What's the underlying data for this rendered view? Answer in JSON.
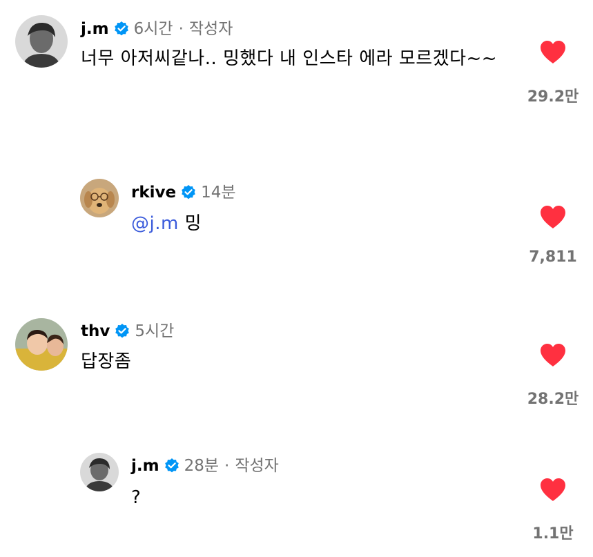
{
  "comments": [
    {
      "username": "j.m",
      "time": "6시간",
      "author_tag": "작성자",
      "text": "너무 아저씨같나.. 밍했다 내 인스타 에라 모르겠다~~",
      "likes": "29.2만",
      "avatar_icon": "profile-photo"
    },
    {
      "username": "rkive",
      "time": "14분",
      "mention": "@j.m",
      "text": "밍",
      "likes": "7,811",
      "avatar_icon": "dog-photo"
    },
    {
      "username": "thv",
      "time": "5시간",
      "text": "답장좀",
      "likes": "28.2만",
      "avatar_icon": "child-photo"
    },
    {
      "username": "j.m",
      "time": "28분",
      "author_tag": "작성자",
      "text": "?",
      "likes": "1.1만",
      "avatar_icon": "profile-photo"
    }
  ],
  "colors": {
    "like_red": "#ff3040",
    "verified_blue": "#0095f6",
    "meta_gray": "#737373",
    "mention_blue": "#3b5bdb"
  }
}
